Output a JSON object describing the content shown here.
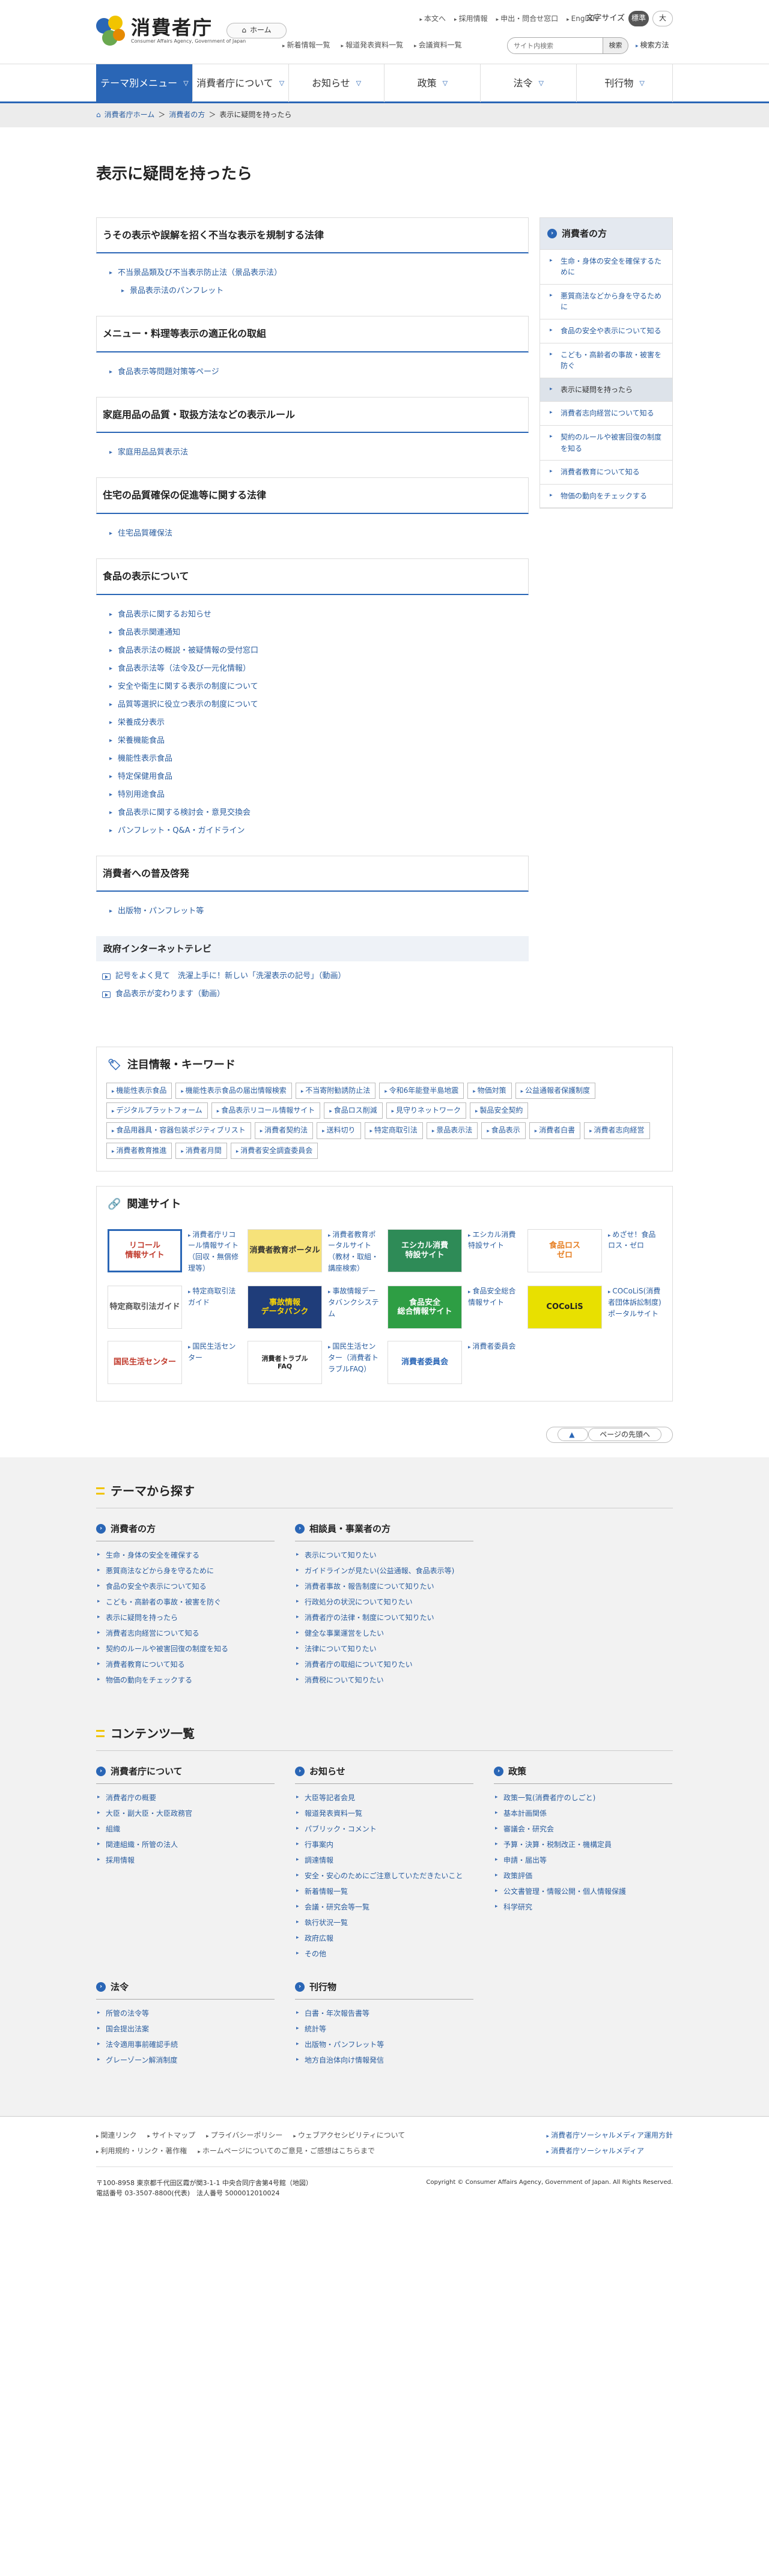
{
  "header": {
    "logo_name": "消費者庁",
    "logo_sub": "Consumer Affairs Agency, Government of Japan",
    "home": "ホーム",
    "util1": [
      "本文へ",
      "採用情報",
      "申出・問合せ窓口",
      "English"
    ],
    "font_size_label": "文字サイズ",
    "font_std": "標準",
    "font_large": "大",
    "util2": [
      "新着情報一覧",
      "報道発表資料一覧",
      "会議資料一覧"
    ],
    "search_placeholder": "サイト内検索",
    "search_btn": "検索",
    "search_method": "検索方法"
  },
  "gnav": [
    "テーマ別メニュー",
    "消費者庁について",
    "お知らせ",
    "政策",
    "法令",
    "刊行物"
  ],
  "breadcrumb": [
    "消費者庁ホーム",
    "消費者の方",
    "表示に疑問を持ったら"
  ],
  "page_title": "表示に疑問を持ったら",
  "sections": [
    {
      "title": "うその表示や誤解を招く不当な表示を規制する法律",
      "items": [
        {
          "label": "不当景品類及び不当表示防止法（景品表示法）",
          "sub": false
        },
        {
          "label": "景品表示法のパンフレット",
          "sub": true
        }
      ]
    },
    {
      "title": "メニュー・料理等表示の適正化の取組",
      "items": [
        {
          "label": "食品表示等問題対策等ページ",
          "sub": false
        }
      ]
    },
    {
      "title": "家庭用品の品質・取扱方法などの表示ルール",
      "items": [
        {
          "label": "家庭用品品質表示法",
          "sub": false
        }
      ]
    },
    {
      "title": "住宅の品質確保の促進等に関する法律",
      "items": [
        {
          "label": "住宅品質確保法",
          "sub": false
        }
      ]
    },
    {
      "title": "食品の表示について",
      "items": [
        {
          "label": "食品表示に関するお知らせ",
          "sub": false
        },
        {
          "label": "食品表示関連通知",
          "sub": false
        },
        {
          "label": "食品表示法の概説・被疑情報の受付窓口",
          "sub": false
        },
        {
          "label": "食品表示法等（法令及び一元化情報）",
          "sub": false
        },
        {
          "label": "安全や衛生に関する表示の制度について",
          "sub": false
        },
        {
          "label": "品質等選択に役立つ表示の制度について",
          "sub": false
        },
        {
          "label": "栄養成分表示",
          "sub": false
        },
        {
          "label": "栄養機能食品",
          "sub": false
        },
        {
          "label": "機能性表示食品",
          "sub": false
        },
        {
          "label": "特定保健用食品",
          "sub": false
        },
        {
          "label": "特別用途食品",
          "sub": false
        },
        {
          "label": "食品表示に関する検討会・意見交換会",
          "sub": false
        },
        {
          "label": "パンフレット・Q&A・ガイドライン",
          "sub": false
        }
      ]
    },
    {
      "title": "消費者への普及啓発",
      "items": [
        {
          "label": "出版物・パンフレット等",
          "sub": false
        }
      ]
    }
  ],
  "tele": {
    "title": "政府インターネットテレビ",
    "items": [
      "記号をよく見て　洗濯上手に！新しい「洗濯表示の記号」（動画）",
      "食品表示が変わります（動画）"
    ]
  },
  "side": {
    "title": "消費者の方",
    "items": [
      {
        "label": "生命・身体の安全を確保するために",
        "current": false
      },
      {
        "label": "悪質商法などから身を守るために",
        "current": false
      },
      {
        "label": "食品の安全や表示について知る",
        "current": false
      },
      {
        "label": "こども・高齢者の事故・被害を防ぐ",
        "current": false
      },
      {
        "label": "表示に疑問を持ったら",
        "current": true
      },
      {
        "label": "消費者志向経営について知る",
        "current": false
      },
      {
        "label": "契約のルールや被害回復の制度を知る",
        "current": false
      },
      {
        "label": "消費者教育について知る",
        "current": false
      },
      {
        "label": "物価の動向をチェックする",
        "current": false
      }
    ]
  },
  "keywords": {
    "title": "注目情報・キーワード",
    "items": [
      "機能性表示食品",
      "機能性表示食品の届出情報検索",
      "不当寄附勧誘防止法",
      "令和6年能登半島地震",
      "物価対策",
      "公益通報者保護制度",
      "デジタルプラットフォーム",
      "食品表示リコール情報サイト",
      "食品ロス削減",
      "見守りネットワーク",
      "製品安全契約",
      "食品用器具・容器包装ポジティブリスト",
      "消費者契約法",
      "送料切り",
      "特定商取引法",
      "景品表示法",
      "食品表示",
      "消費者白書",
      "消費者志向経営",
      "消費者教育推進",
      "消費者月間",
      "消費者安全調査委員会"
    ]
  },
  "related": {
    "title": "関連サイト",
    "items": [
      {
        "img": "リコール\n情報サイト",
        "label": "消費者庁リコール情報サイト（回収・無償修理等）"
      },
      {
        "img": "消費者教育ポータル",
        "label": "消費者教育ポータルサイト（教材・取組・講座検索）"
      },
      {
        "img": "エシカル消費\n特設サイト",
        "label": "エシカル消費特設サイト"
      },
      {
        "img": "食品ロス\nゼロ",
        "label": "めざせ！食品ロス・ゼロ"
      },
      {
        "img": "特定商取引法ガイド",
        "label": "特定商取引法ガイド"
      },
      {
        "img": "事故情報\nデータバンク",
        "label": "事故情報データバンクシステム"
      },
      {
        "img": "食品安全\n総合情報サイト",
        "label": "食品安全総合情報サイト"
      },
      {
        "img": "COCoLiS",
        "label": "COCoLiS(消費者団体訴訟制度)ポータルサイト"
      },
      {
        "img": "国民生活センター",
        "label": "国民生活センター"
      },
      {
        "img": "消費者トラブル\nFAQ",
        "label": "国民生活センター（消費者トラブルFAQ）"
      },
      {
        "img": "消費者委員会",
        "label": "消費者委員会"
      }
    ]
  },
  "to_top": "ページの先頭へ",
  "theme": {
    "title": "テーマから探す",
    "cols": [
      {
        "title": "消費者の方",
        "items": [
          "生命・身体の安全を確保する",
          "悪質商法などから身を守るために",
          "食品の安全や表示について知る",
          "こども・高齢者の事故・被害を防ぐ",
          "表示に疑問を持ったら",
          "消費者志向経営について知る",
          "契約のルールや被害回復の制度を知る",
          "消費者教育について知る",
          "物価の動向をチェックする"
        ]
      },
      {
        "title": "相談員・事業者の方",
        "items": [
          "表示について知りたい",
          "ガイドラインが見たい(公益通報、食品表示等)",
          "消費者事故・報告制度について知りたい",
          "行政処分の状況について知りたい",
          "消費者庁の法律・制度について知りたい",
          "健全な事業運営をしたい",
          "法律について知りたい",
          "消費者庁の取組について知りたい",
          "消費税について知りたい"
        ]
      }
    ]
  },
  "contents": {
    "title": "コンテンツ一覧",
    "cols": [
      {
        "title": "消費者庁について",
        "items": [
          "消費者庁の概要",
          "大臣・副大臣・大臣政務官",
          "組織",
          "関連組織・所管の法人",
          "採用情報"
        ]
      },
      {
        "title": "お知らせ",
        "items": [
          "大臣等記者会見",
          "報道発表資料一覧",
          "パブリック・コメント",
          "行事案内",
          "調達情報",
          "安全・安心のためにご注意していただきたいこと",
          "新着情報一覧",
          "会議・研究会等一覧",
          "執行状況一覧",
          "政府広報",
          "その他"
        ]
      },
      {
        "title": "政策",
        "items": [
          "政策一覧(消費者庁のしごと)",
          "基本計画関係",
          "審議会・研究会",
          "予算・決算・税制改正・機構定員",
          "申請・届出等",
          "政策評価",
          "公文書管理・情報公開・個人情報保護",
          "科学研究"
        ]
      },
      {
        "title": "法令",
        "items": [
          "所管の法令等",
          "国会提出法案",
          "法令適用事前確認手続",
          "グレーゾーン解消制度"
        ]
      },
      {
        "title": "刊行物",
        "items": [
          "白書・年次報告書等",
          "統計等",
          "出版物・パンフレット等",
          "地方自治体向け情報発信"
        ]
      }
    ]
  },
  "footer": {
    "links1": [
      "関連リンク",
      "サイトマップ",
      "プライバシーポリシー",
      "ウェブアクセシビリティについて"
    ],
    "links2": [
      "利用規約・リンク・著作権",
      "ホームページについてのご意見・ご感想はこちらまで"
    ],
    "sns1": "消費者庁ソーシャルメディア運用方針",
    "sns2": "消費者庁ソーシャルメディア",
    "address": "〒100-8958 東京都千代田区霞が関3-1-1 中央合同庁舎第4号館（地図）",
    "tel": "電話番号 03-3507-8800(代表)　法人番号 5000012010024",
    "copyright": "Copyright © Consumer Affairs Agency, Government of Japan. All Rights Reserved."
  },
  "colors": {
    "accent": "#2a66b6",
    "highlight": "#f1c400"
  }
}
